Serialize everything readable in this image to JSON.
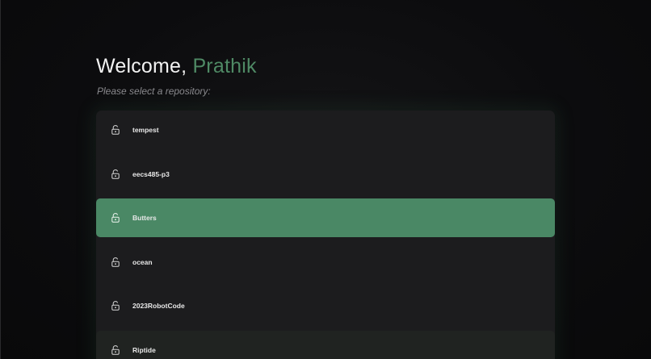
{
  "header": {
    "greeting": "Welcome,",
    "username": "Prathik",
    "prompt": "Please select a repository:"
  },
  "repositories": [
    {
      "name": "tempest",
      "icon": "unlock-icon",
      "state": "default"
    },
    {
      "name": "eecs485-p3",
      "icon": "unlock-icon",
      "state": "default"
    },
    {
      "name": "Butters",
      "icon": "unlock-icon",
      "state": "selected"
    },
    {
      "name": "ocean",
      "icon": "unlock-icon",
      "state": "default"
    },
    {
      "name": "2023RobotCode",
      "icon": "unlock-icon",
      "state": "default"
    },
    {
      "name": "Riptide",
      "icon": "unlock-icon",
      "state": "hover"
    }
  ],
  "colors": {
    "accent": "#4f8a65",
    "selected_row": "#4a8865",
    "panel": "#1c1c1e",
    "background": "#0b0b0d"
  }
}
